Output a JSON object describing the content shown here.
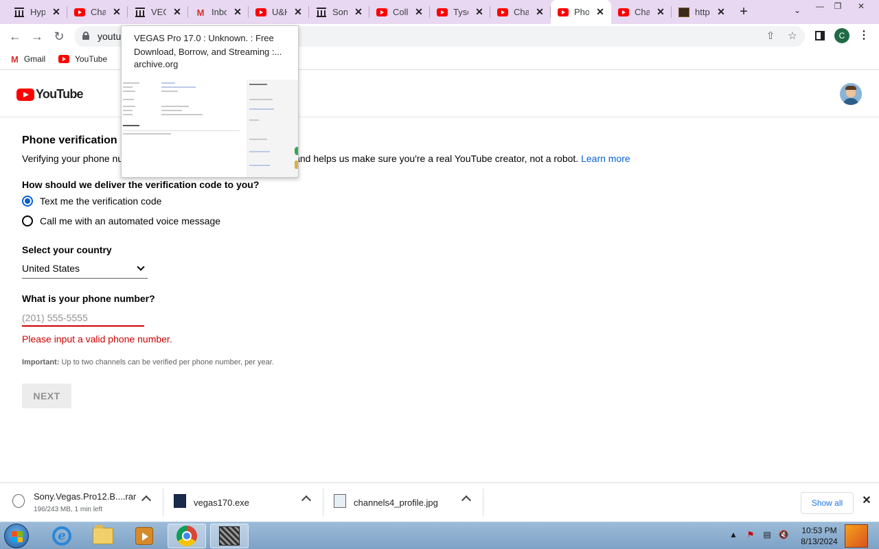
{
  "browser": {
    "tabs": [
      {
        "title": "Hyp",
        "favicon": "archive-icon"
      },
      {
        "title": "Cha",
        "favicon": "youtube-icon"
      },
      {
        "title": "VEG",
        "favicon": "archive-icon"
      },
      {
        "title": "Inbo",
        "favicon": "gmail-icon"
      },
      {
        "title": "U&H",
        "favicon": "youtube-icon"
      },
      {
        "title": "Sony",
        "favicon": "archive-icon"
      },
      {
        "title": "Colla",
        "favicon": "youtube-icon"
      },
      {
        "title": "Tyso",
        "favicon": "youtube-icon"
      },
      {
        "title": "Cha",
        "favicon": "youtube-icon"
      },
      {
        "title": "Pho",
        "favicon": "youtube-icon",
        "active": true
      },
      {
        "title": "Cha",
        "favicon": "youtube-icon"
      },
      {
        "title": "http",
        "favicon": "generic-page-icon"
      }
    ],
    "new_tab_label": "+",
    "url": "youtu",
    "profile_initial": "C",
    "bookmarks": [
      {
        "label": "Gmail",
        "icon": "gmail-icon"
      },
      {
        "label": "YouTube",
        "icon": "youtube-icon"
      }
    ]
  },
  "hover_card": {
    "title": "VEGAS Pro 17.0 : Unknown. : Free Download, Borrow, and Streaming :...",
    "domain": "archive.org"
  },
  "page": {
    "logo_text": "YouTube",
    "title": "Phone verification (s",
    "description": "Verifying your phone nu",
    "description_tail": "on YouTube, and helps us make sure you're a real YouTube creator, not a robot.",
    "learn_more": "Learn more",
    "delivery_question": "How should we deliver the verification code to you?",
    "options": [
      {
        "label": "Text me the verification code",
        "checked": true
      },
      {
        "label": "Call me with an automated voice message",
        "checked": false
      }
    ],
    "country_label": "Select your country",
    "country_value": "United States",
    "phone_label": "What is your phone number?",
    "phone_placeholder": "(201) 555-5555",
    "phone_value": "",
    "error": "Please input a valid phone number.",
    "important_label": "Important:",
    "important_text": "Up to two channels can be verified per phone number, per year.",
    "next_button": "NEXT"
  },
  "downloads": {
    "items": [
      {
        "name": "Sony.Vegas.Pro12.B....rar",
        "status": "196/243 MB, 1 min left",
        "icon": "file-icon"
      },
      {
        "name": "vegas170.exe",
        "status": "",
        "icon": "vegas-exe-icon"
      },
      {
        "name": "channels4_profile.jpg",
        "status": "",
        "icon": "image-file-icon"
      }
    ],
    "show_all": "Show all"
  },
  "taskbar": {
    "apps": [
      "internet-explorer-icon",
      "file-explorer-icon",
      "media-player-icon",
      "chrome-icon",
      "vegas-icon"
    ],
    "time": "10:53 PM",
    "date": "8/13/2024"
  }
}
